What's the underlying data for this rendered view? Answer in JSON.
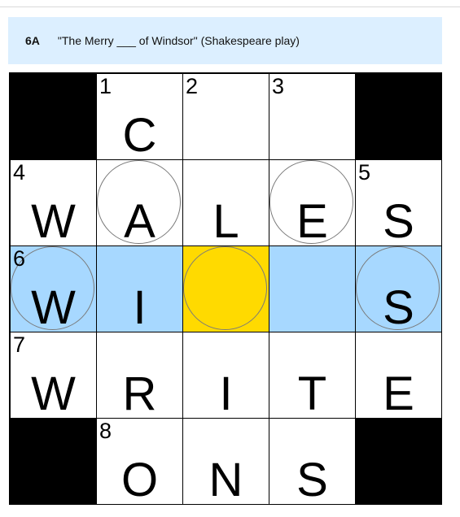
{
  "clue": {
    "number": "6A",
    "text": "\"The Merry ___ of Windsor\" (Shakespeare play)"
  },
  "colors": {
    "clue_bar": "#dcefff",
    "word_highlight": "#a7d8ff",
    "selected_cell": "#ffda00",
    "block": "#000000"
  },
  "grid": {
    "rows": [
      [
        {
          "block": true
        },
        {
          "number": "1",
          "letter": "C"
        },
        {
          "number": "2",
          "letter": ""
        },
        {
          "number": "3",
          "letter": ""
        },
        {
          "block": true
        }
      ],
      [
        {
          "number": "4",
          "letter": "W"
        },
        {
          "letter": "A",
          "circled": true
        },
        {
          "letter": "L"
        },
        {
          "letter": "E",
          "circled": true
        },
        {
          "number": "5",
          "letter": "S"
        }
      ],
      [
        {
          "number": "6",
          "letter": "W",
          "circled": true,
          "highlight": "word"
        },
        {
          "letter": "I",
          "highlight": "word"
        },
        {
          "letter": "",
          "circled": true,
          "highlight": "selected"
        },
        {
          "letter": "",
          "highlight": "word"
        },
        {
          "letter": "S",
          "circled": true,
          "highlight": "word"
        }
      ],
      [
        {
          "number": "7",
          "letter": "W"
        },
        {
          "letter": "R"
        },
        {
          "letter": "I"
        },
        {
          "letter": "T"
        },
        {
          "letter": "E"
        }
      ],
      [
        {
          "block": true
        },
        {
          "number": "8",
          "letter": "O"
        },
        {
          "letter": "N"
        },
        {
          "letter": "S"
        },
        {
          "block": true
        }
      ]
    ]
  }
}
